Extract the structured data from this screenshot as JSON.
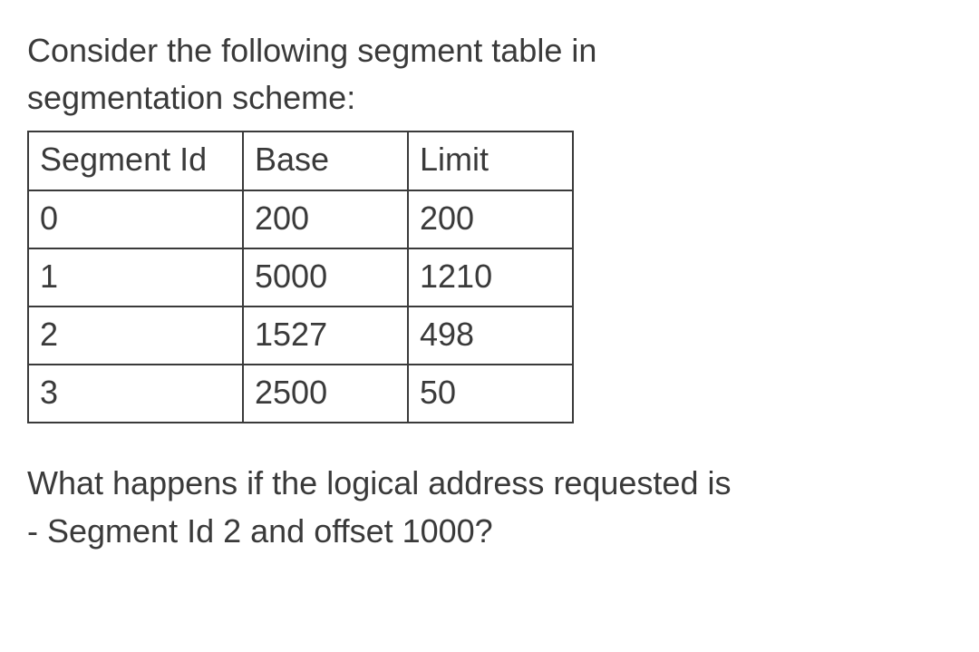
{
  "intro_line1": "Consider the following segment table in",
  "intro_line2": "segmentation scheme:",
  "table": {
    "headers": {
      "segment_id": "Segment Id",
      "base": "Base",
      "limit": "Limit"
    },
    "rows": [
      {
        "segment_id": "0",
        "base": "200",
        "limit": "200"
      },
      {
        "segment_id": "1",
        "base": "5000",
        "limit": "1210"
      },
      {
        "segment_id": "2",
        "base": "1527",
        "limit": "498"
      },
      {
        "segment_id": "3",
        "base": "2500",
        "limit": "50"
      }
    ]
  },
  "question_line1": "What happens if the logical address requested is",
  "question_line2": "- Segment Id 2 and offset 1000?"
}
